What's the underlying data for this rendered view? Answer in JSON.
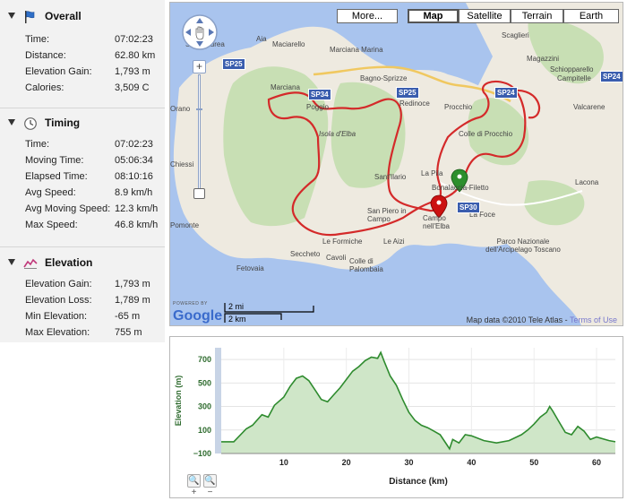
{
  "sections": {
    "overall": {
      "title": "Overall",
      "icon": "flag-icon",
      "rows": [
        {
          "label": "Time:",
          "value": "07:02:23"
        },
        {
          "label": "Distance:",
          "value": "62.80 km"
        },
        {
          "label": "Elevation Gain:",
          "value": "1,793 m"
        },
        {
          "label": "Calories:",
          "value": "3,509 C"
        }
      ]
    },
    "timing": {
      "title": "Timing",
      "icon": "clock-icon",
      "rows": [
        {
          "label": "Time:",
          "value": "07:02:23"
        },
        {
          "label": "Moving Time:",
          "value": "05:06:34"
        },
        {
          "label": "Elapsed Time:",
          "value": "08:10:16"
        },
        {
          "label": "Avg Speed:",
          "value": "8.9 km/h"
        },
        {
          "label": "Avg Moving Speed:",
          "value": "12.3 km/h"
        },
        {
          "label": "Max Speed:",
          "value": "46.8 km/h"
        }
      ]
    },
    "elevation": {
      "title": "Elevation",
      "icon": "elevation-profile-icon",
      "rows": [
        {
          "label": "Elevation Gain:",
          "value": "1,793 m"
        },
        {
          "label": "Elevation Loss:",
          "value": "1,789 m"
        },
        {
          "label": "Min Elevation:",
          "value": "-65 m"
        },
        {
          "label": "Max Elevation:",
          "value": "755 m"
        }
      ]
    }
  },
  "map": {
    "map_types": [
      {
        "label": "More...",
        "active": false
      },
      {
        "label": "Map",
        "active": true
      },
      {
        "label": "Satellite",
        "active": false
      },
      {
        "label": "Terrain",
        "active": false
      },
      {
        "label": "Earth",
        "active": false
      }
    ],
    "places": [
      "Sant'Andrea",
      "Aia",
      "Maciarello",
      "Marciana Marina",
      "Marciana",
      "Poggio",
      "Isola d'Elba",
      "Bagno-Sprizze",
      "Redinoce",
      "Procchio",
      "Colle di Procchio",
      "Scaglieri",
      "Magazzini",
      "Schiopparello",
      "Campitelle",
      "Valcarene",
      "Lacona",
      "La Pila",
      "Bonalaccia-Filetto",
      "La Foce",
      "Sant'Ilario",
      "San Piero in Campo",
      "Campo nell'Elba",
      "Le Formiche",
      "Le Aizi",
      "Seccheto",
      "Cavoli",
      "Colle di Palombaia",
      "Fetovaia",
      "Pomonte",
      "Orano",
      "Chiessi",
      "Parco Nazionale dell'Arcipelago Toscano"
    ],
    "roads": [
      "SP25",
      "SP34",
      "SP25",
      "SP24",
      "SP30",
      "SP24"
    ],
    "scale": {
      "imperial": "2 mi",
      "metric": "2 km"
    },
    "logo_small": "POWERED BY",
    "logo_word": "Google",
    "attribution": "Map data ©2010 Tele Atlas - ",
    "terms_link": "Terms of Use"
  },
  "chart_data": {
    "type": "area",
    "title": "",
    "xlabel": "Distance (km)",
    "ylabel": "Elevation (m)",
    "xlim": [
      0,
      63
    ],
    "ylim": [
      -100,
      800
    ],
    "x_ticks": [
      10,
      20,
      30,
      40,
      50,
      60
    ],
    "y_ticks": [
      -100,
      100,
      300,
      500,
      700
    ],
    "grid": true,
    "color": "#2e8b2e",
    "fill": "#cfe6c8",
    "series": [
      {
        "x": [
          0,
          2,
          4,
          5,
          6.5,
          7.5,
          8.5,
          10,
          11,
          12,
          13,
          14,
          15,
          16,
          17,
          18,
          19,
          20,
          21,
          22,
          23,
          24,
          25,
          25.5,
          26,
          27,
          28,
          29,
          30,
          31,
          32,
          33,
          34,
          35,
          36,
          36.5,
          37,
          38,
          39,
          40,
          42,
          44,
          46,
          48,
          49,
          50,
          51,
          52,
          52.5,
          53,
          54,
          55,
          56,
          57,
          58,
          59,
          60,
          62,
          63
        ],
        "y": [
          0,
          0,
          110,
          140,
          230,
          210,
          310,
          380,
          470,
          540,
          560,
          520,
          440,
          360,
          340,
          400,
          460,
          530,
          600,
          640,
          690,
          720,
          710,
          760,
          690,
          560,
          480,
          360,
          250,
          180,
          140,
          120,
          90,
          60,
          -20,
          -60,
          20,
          -10,
          60,
          50,
          10,
          -10,
          10,
          60,
          100,
          150,
          210,
          250,
          300,
          260,
          170,
          80,
          60,
          130,
          90,
          20,
          40,
          10,
          0
        ]
      }
    ]
  },
  "chart_controls": {
    "zoom_in": "🔍+",
    "zoom_out": "🔍−"
  }
}
